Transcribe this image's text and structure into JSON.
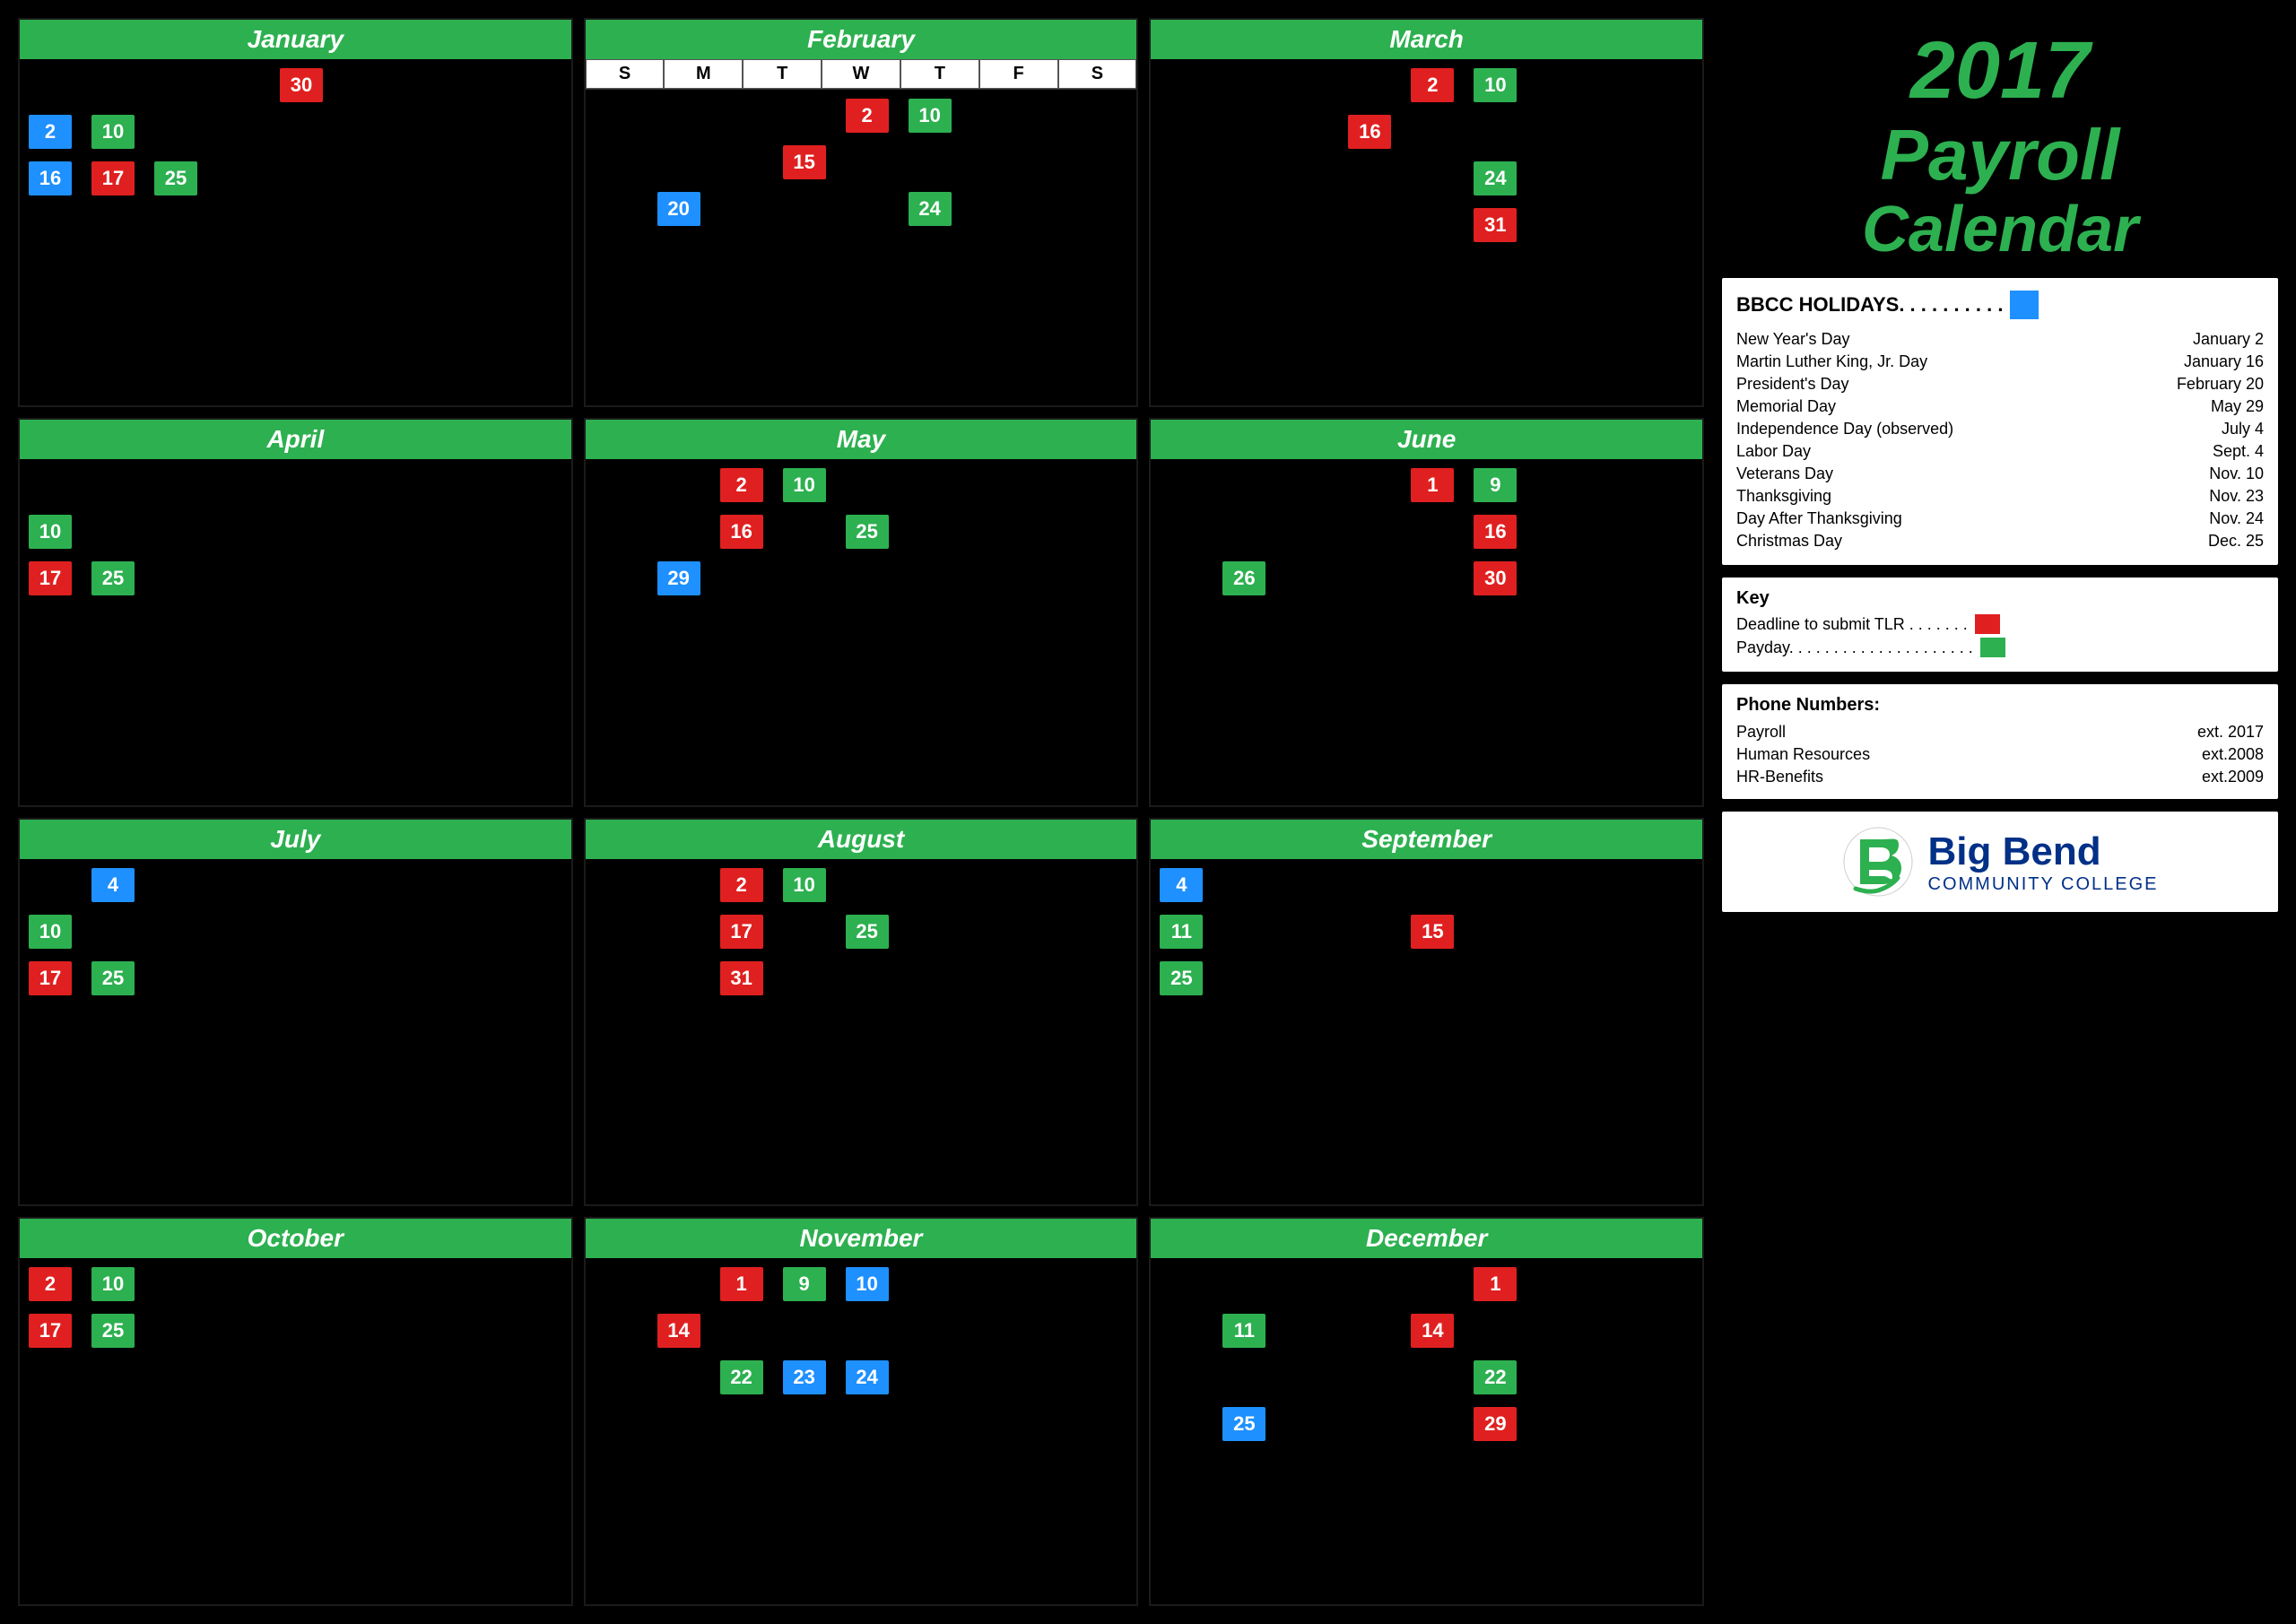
{
  "title": {
    "year": "2017",
    "line1": "Payroll",
    "line2": "Calendar"
  },
  "months": [
    {
      "name": "January",
      "show_dow": false,
      "badges": [
        {
          "num": "30",
          "type": "red",
          "col": 4,
          "row": 0
        },
        {
          "num": "2",
          "type": "blue",
          "col": 0,
          "row": 1
        },
        {
          "num": "10",
          "type": "green",
          "col": 1,
          "row": 1
        },
        {
          "num": "16",
          "type": "blue",
          "col": 0,
          "row": 2
        },
        {
          "num": "17",
          "type": "red",
          "col": 1,
          "row": 2
        },
        {
          "num": "25",
          "type": "green",
          "col": 2,
          "row": 2
        }
      ]
    },
    {
      "name": "February",
      "show_dow": true,
      "badges": [
        {
          "num": "2",
          "type": "red",
          "col": 4,
          "row": 0
        },
        {
          "num": "10",
          "type": "green",
          "col": 5,
          "row": 0
        },
        {
          "num": "15",
          "type": "red",
          "col": 3,
          "row": 1
        },
        {
          "num": "20",
          "type": "blue",
          "col": 1,
          "row": 2
        },
        {
          "num": "24",
          "type": "green",
          "col": 5,
          "row": 2
        }
      ]
    },
    {
      "name": "March",
      "show_dow": false,
      "badges": [
        {
          "num": "2",
          "type": "red",
          "col": 4,
          "row": 0
        },
        {
          "num": "10",
          "type": "green",
          "col": 5,
          "row": 0
        },
        {
          "num": "16",
          "type": "red",
          "col": 3,
          "row": 1
        },
        {
          "num": "24",
          "type": "green",
          "col": 5,
          "row": 2
        },
        {
          "num": "31",
          "type": "red",
          "col": 5,
          "row": 3
        }
      ]
    },
    {
      "name": "April",
      "show_dow": false,
      "badges": [
        {
          "num": "10",
          "type": "green",
          "col": 0,
          "row": 1
        },
        {
          "num": "17",
          "type": "red",
          "col": 0,
          "row": 2
        },
        {
          "num": "25",
          "type": "green",
          "col": 1,
          "row": 2
        }
      ]
    },
    {
      "name": "May",
      "show_dow": false,
      "badges": [
        {
          "num": "2",
          "type": "red",
          "col": 2,
          "row": 0
        },
        {
          "num": "10",
          "type": "green",
          "col": 3,
          "row": 0
        },
        {
          "num": "16",
          "type": "red",
          "col": 2,
          "row": 1
        },
        {
          "num": "25",
          "type": "green",
          "col": 4,
          "row": 1
        },
        {
          "num": "29",
          "type": "blue",
          "col": 1,
          "row": 2
        }
      ]
    },
    {
      "name": "June",
      "show_dow": false,
      "badges": [
        {
          "num": "1",
          "type": "red",
          "col": 4,
          "row": 0
        },
        {
          "num": "9",
          "type": "green",
          "col": 5,
          "row": 0
        },
        {
          "num": "16",
          "type": "red",
          "col": 5,
          "row": 1
        },
        {
          "num": "26",
          "type": "green",
          "col": 1,
          "row": 2
        },
        {
          "num": "30",
          "type": "red",
          "col": 5,
          "row": 2
        }
      ]
    },
    {
      "name": "July",
      "show_dow": false,
      "badges": [
        {
          "num": "4",
          "type": "blue",
          "col": 1,
          "row": 0
        },
        {
          "num": "10",
          "type": "green",
          "col": 0,
          "row": 1
        },
        {
          "num": "17",
          "type": "red",
          "col": 0,
          "row": 2
        },
        {
          "num": "25",
          "type": "green",
          "col": 1,
          "row": 2
        }
      ]
    },
    {
      "name": "August",
      "show_dow": false,
      "badges": [
        {
          "num": "2",
          "type": "red",
          "col": 2,
          "row": 0
        },
        {
          "num": "10",
          "type": "green",
          "col": 3,
          "row": 0
        },
        {
          "num": "17",
          "type": "red",
          "col": 2,
          "row": 1
        },
        {
          "num": "25",
          "type": "green",
          "col": 4,
          "row": 1
        },
        {
          "num": "31",
          "type": "red",
          "col": 2,
          "row": 2
        }
      ]
    },
    {
      "name": "September",
      "show_dow": false,
      "badges": [
        {
          "num": "4",
          "type": "blue",
          "col": 0,
          "row": 0
        },
        {
          "num": "11",
          "type": "green",
          "col": 0,
          "row": 1
        },
        {
          "num": "15",
          "type": "red",
          "col": 4,
          "row": 1
        },
        {
          "num": "25",
          "type": "green",
          "col": 0,
          "row": 2
        }
      ]
    },
    {
      "name": "October",
      "show_dow": false,
      "badges": [
        {
          "num": "2",
          "type": "red",
          "col": 0,
          "row": 0
        },
        {
          "num": "10",
          "type": "green",
          "col": 1,
          "row": 0
        },
        {
          "num": "17",
          "type": "red",
          "col": 0,
          "row": 1
        },
        {
          "num": "25",
          "type": "green",
          "col": 1,
          "row": 1
        }
      ]
    },
    {
      "name": "November",
      "show_dow": false,
      "badges": [
        {
          "num": "1",
          "type": "red",
          "col": 2,
          "row": 0
        },
        {
          "num": "9",
          "type": "green",
          "col": 3,
          "row": 0
        },
        {
          "num": "10",
          "type": "blue",
          "col": 4,
          "row": 0
        },
        {
          "num": "14",
          "type": "red",
          "col": 1,
          "row": 1
        },
        {
          "num": "22",
          "type": "green",
          "col": 2,
          "row": 2
        },
        {
          "num": "23",
          "type": "blue",
          "col": 3,
          "row": 2
        },
        {
          "num": "24",
          "type": "blue",
          "col": 4,
          "row": 2
        }
      ]
    },
    {
      "name": "December",
      "show_dow": false,
      "badges": [
        {
          "num": "1",
          "type": "red",
          "col": 5,
          "row": 0
        },
        {
          "num": "11",
          "type": "green",
          "col": 1,
          "row": 1
        },
        {
          "num": "14",
          "type": "red",
          "col": 4,
          "row": 1
        },
        {
          "num": "22",
          "type": "green",
          "col": 5,
          "row": 2
        },
        {
          "num": "25",
          "type": "blue",
          "col": 1,
          "row": 3
        },
        {
          "num": "29",
          "type": "red",
          "col": 5,
          "row": 3
        }
      ]
    }
  ],
  "holidays_header": "BBCC HOLIDAYS. . . . . . . . . .",
  "holidays": [
    {
      "name": "New Year's Day",
      "date": "January 2"
    },
    {
      "name": "Martin Luther King, Jr. Day",
      "date": "January 16"
    },
    {
      "name": "President's Day",
      "date": "February 20"
    },
    {
      "name": "Memorial Day",
      "date": "May 29"
    },
    {
      "name": "Independence Day (observed)",
      "date": "July 4"
    },
    {
      "name": "Labor Day",
      "date": "Sept. 4"
    },
    {
      "name": "Veterans Day",
      "date": "Nov. 10"
    },
    {
      "name": "Thanksgiving",
      "date": "Nov. 23"
    },
    {
      "name": "Day After Thanksgiving",
      "date": "Nov. 24"
    },
    {
      "name": "Christmas Day",
      "date": "Dec. 25"
    }
  ],
  "key": {
    "title": "Key",
    "deadline": "Deadline to submit TLR . . . . . . .",
    "payday": "Payday. . . . . . . . . . . . . . . . . . . . ."
  },
  "phone": {
    "title": "Phone Numbers:",
    "rows": [
      {
        "label": "Payroll",
        "value": "ext. 2017"
      },
      {
        "label": "Human Resources",
        "value": "ext.2008"
      },
      {
        "label": "HR-Benefits",
        "value": "ext.2009"
      }
    ]
  },
  "logo": {
    "bigbend": "Big Bend",
    "community": "COMMUNITY COLLEGE"
  },
  "dow_labels": [
    "S",
    "M",
    "T",
    "W",
    "T",
    "F",
    "S"
  ]
}
